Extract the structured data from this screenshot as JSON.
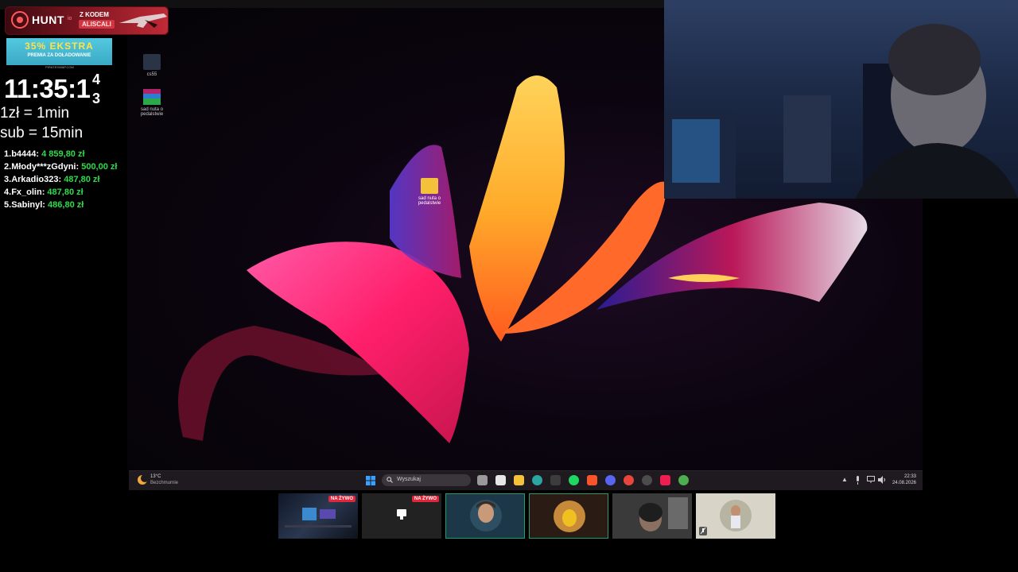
{
  "hunt_banner": {
    "brand": "HUNT",
    "brand_suffix": "io",
    "code_label": "Z KODEM",
    "code_value": "ALISCALI"
  },
  "promo": {
    "title": "35% EKSTRA",
    "subtitle": "PREMIA ZA DOŁADOWANIE",
    "url": "PIRATESWAP.COM"
  },
  "subathon": {
    "timer": "11:35:1",
    "timer_digit_top": "4",
    "timer_digit_bottom": "3",
    "rate_zl": "1zł = 1min",
    "rate_sub": "sub = 15min"
  },
  "leaderboard": [
    {
      "rank": "1.",
      "name": "b4444:",
      "amount": "4 859,80 zł"
    },
    {
      "rank": "2.",
      "name": "Młody***zGdyni:",
      "amount": "500,00 zł"
    },
    {
      "rank": "3.",
      "name": "Arkadio323:",
      "amount": "487,80 zł"
    },
    {
      "rank": "4.",
      "name": "Fx_olin:",
      "amount": "487,80 zł"
    },
    {
      "rank": "5.",
      "name": "Sabinyl:",
      "amount": "486,80 zł"
    }
  ],
  "desktop": {
    "icons": [
      {
        "label": "cs55",
        "icon": "app-icon"
      },
      {
        "label": "sad nuta o pedalstwie",
        "icon": "winrar-icon"
      },
      {
        "label": "sad nuta o pedalstwie",
        "icon": "folder-icon"
      }
    ]
  },
  "taskbar": {
    "weather_temp": "13°C",
    "weather_desc": "Bezchmurnie",
    "search_placeholder": "Wyszukaj",
    "clock_time": "22:33",
    "clock_date": "24.08.2026",
    "apps": [
      {
        "name": "task-view-icon",
        "color": "#9a9a9a"
      },
      {
        "name": "store-icon",
        "color": "#e6e6e6"
      },
      {
        "name": "file-explorer-icon",
        "color": "#f3c13a"
      },
      {
        "name": "edge-icon",
        "color": "#2aa7a0"
      },
      {
        "name": "terminal-icon",
        "color": "#3c3c3c"
      },
      {
        "name": "spotify-icon",
        "color": "#1ed760"
      },
      {
        "name": "brave-icon",
        "color": "#fb542b"
      },
      {
        "name": "discord-icon",
        "color": "#5865f2"
      },
      {
        "name": "chrome-icon",
        "color": "#e8453c"
      },
      {
        "name": "obs-icon",
        "color": "#4c4c4c"
      },
      {
        "name": "tiktok-icon",
        "color": "#ee1d52"
      },
      {
        "name": "chrome-beta-icon",
        "color": "#4cae4f"
      }
    ]
  },
  "participants": [
    {
      "label": "screen-share-1",
      "live": "NA ŻYWO"
    },
    {
      "label": "screen-share-2",
      "live": "NA ŻYWO"
    },
    {
      "label": "participant-1",
      "live": ""
    },
    {
      "label": "participant-2",
      "live": ""
    },
    {
      "label": "participant-3",
      "live": ""
    },
    {
      "label": "participant-4",
      "live": ""
    }
  ],
  "colors": {
    "accent_green": "#2edc4a",
    "live_red": "#e0263b",
    "speaking_border": "#2a9a6a"
  }
}
